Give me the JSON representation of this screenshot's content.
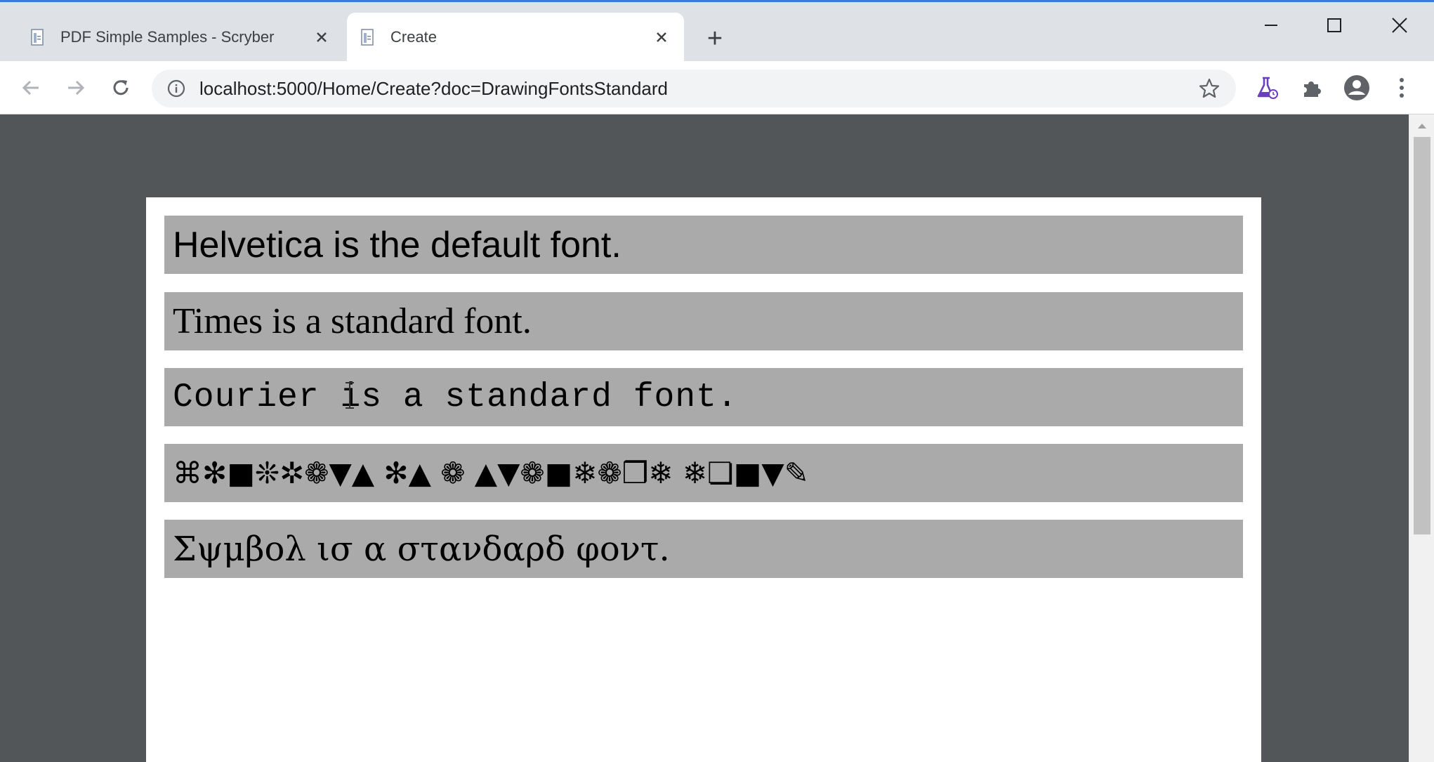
{
  "tabs": [
    {
      "title": "PDF Simple Samples - Scryber",
      "active": false
    },
    {
      "title": "Create",
      "active": true
    }
  ],
  "new_tab_label": "+",
  "address_bar": {
    "url": "localhost:5000/Home/Create?doc=DrawingFontsStandard"
  },
  "pdf": {
    "blocks": [
      {
        "text": "Helvetica is the default font."
      },
      {
        "text": "Times is a standard font."
      },
      {
        "text": "Courier is a standard font."
      },
      {
        "text": "⌘✻■❊✲❁▼▲ ✻▲ ❁ ▲▼❁■❄❁❒❄ ❄❏■▼✎"
      },
      {
        "text": "Σψμβολ ισ α στανδαρδ φοντ."
      }
    ]
  },
  "colors": {
    "tabstrip_bg": "#dee1e6",
    "viewer_bg": "#525659",
    "block_bg": "#aaaaaa",
    "labs_icon": "#6a3fbf"
  },
  "icons": [
    "file-icon",
    "close-icon",
    "back-icon",
    "forward-icon",
    "reload-icon",
    "info-icon",
    "star-icon",
    "labs-flask-icon",
    "extensions-icon",
    "profile-icon",
    "menu-icon",
    "minimize-icon",
    "maximize-icon",
    "window-close-icon"
  ]
}
